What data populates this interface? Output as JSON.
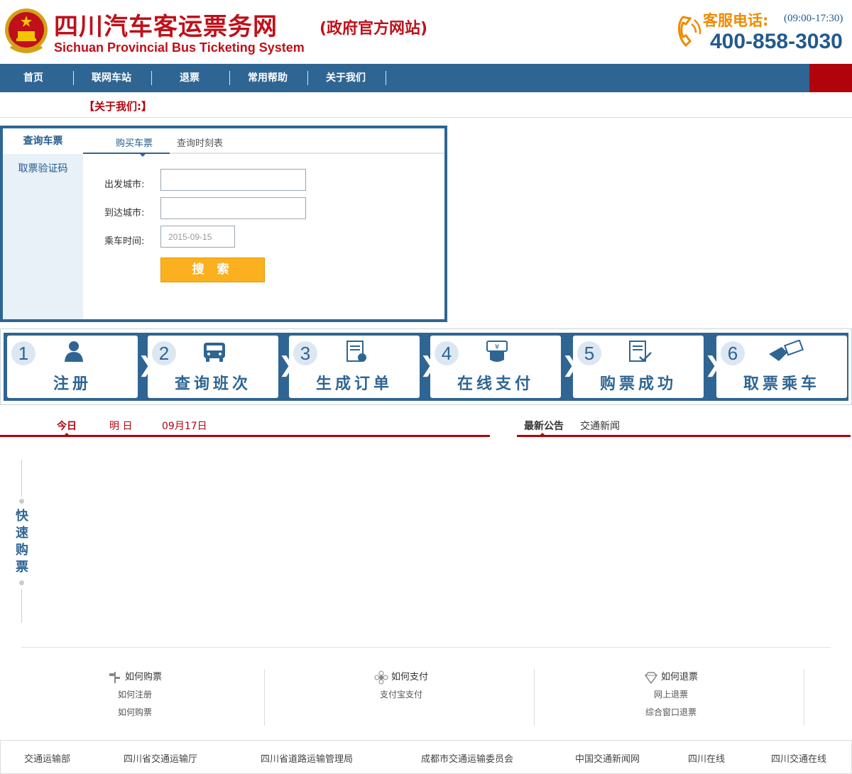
{
  "header": {
    "title": "四川汽车客运票务网",
    "subtitle": "(政府官方网站)",
    "title_en": "Sichuan Provincial Bus Ticketing System",
    "hotline_label": "客服电话:",
    "hotline_hours": "(09:00-17:30)",
    "hotline_number": "400-858-3030"
  },
  "nav": {
    "items": [
      "首页",
      "联网车站",
      "退票",
      "常用帮助",
      "关于我们"
    ]
  },
  "about": {
    "label": "【关于我们:】"
  },
  "search_panel": {
    "side_tabs": [
      "查询车票",
      "取票验证码"
    ],
    "tabs": [
      "购买车票",
      "查询时刻表"
    ],
    "depart_label": "出发城市:",
    "depart_value": "",
    "arrive_label": "到达城市:",
    "arrive_value": "",
    "date_label": "乘车时间:",
    "date_value": "2015-09-15",
    "search_button": "搜 索"
  },
  "steps": [
    {
      "num": "1",
      "label": "注册",
      "icon": "user-icon"
    },
    {
      "num": "2",
      "label": "查询班次",
      "icon": "bus-icon"
    },
    {
      "num": "3",
      "label": "生成订单",
      "icon": "order-document-icon"
    },
    {
      "num": "4",
      "label": "在线支付",
      "icon": "payment-hand-icon"
    },
    {
      "num": "5",
      "label": "购票成功",
      "icon": "success-document-icon"
    },
    {
      "num": "6",
      "label": "取票乘车",
      "icon": "ticket-hand-icon"
    }
  ],
  "date_tabs": [
    "今日",
    "明 日",
    "09月17日"
  ],
  "news_tabs": [
    "最新公告",
    "交通新闻"
  ],
  "quick_buy": [
    "快",
    "速",
    "购",
    "票"
  ],
  "help": [
    {
      "title": "如何购票",
      "icon": "signpost-icon",
      "links": [
        "如何注册",
        "如何购票"
      ]
    },
    {
      "title": "如何支付",
      "icon": "gear-flower-icon",
      "links": [
        "支付宝支付"
      ]
    },
    {
      "title": "如何退票",
      "icon": "diamond-icon",
      "links": [
        "网上退票",
        "综合窗口退票"
      ]
    }
  ],
  "footer_links": [
    "交通运输部",
    "四川省交通运输厅",
    "四川省道路运输管理局",
    "成都市交通运输委员会",
    "中国交通新闻网",
    "四川在线",
    "四川交通在线"
  ],
  "colors": {
    "brand_red": "#b0030c",
    "nav_blue": "#2f6593",
    "accent_orange": "#fbb020"
  }
}
